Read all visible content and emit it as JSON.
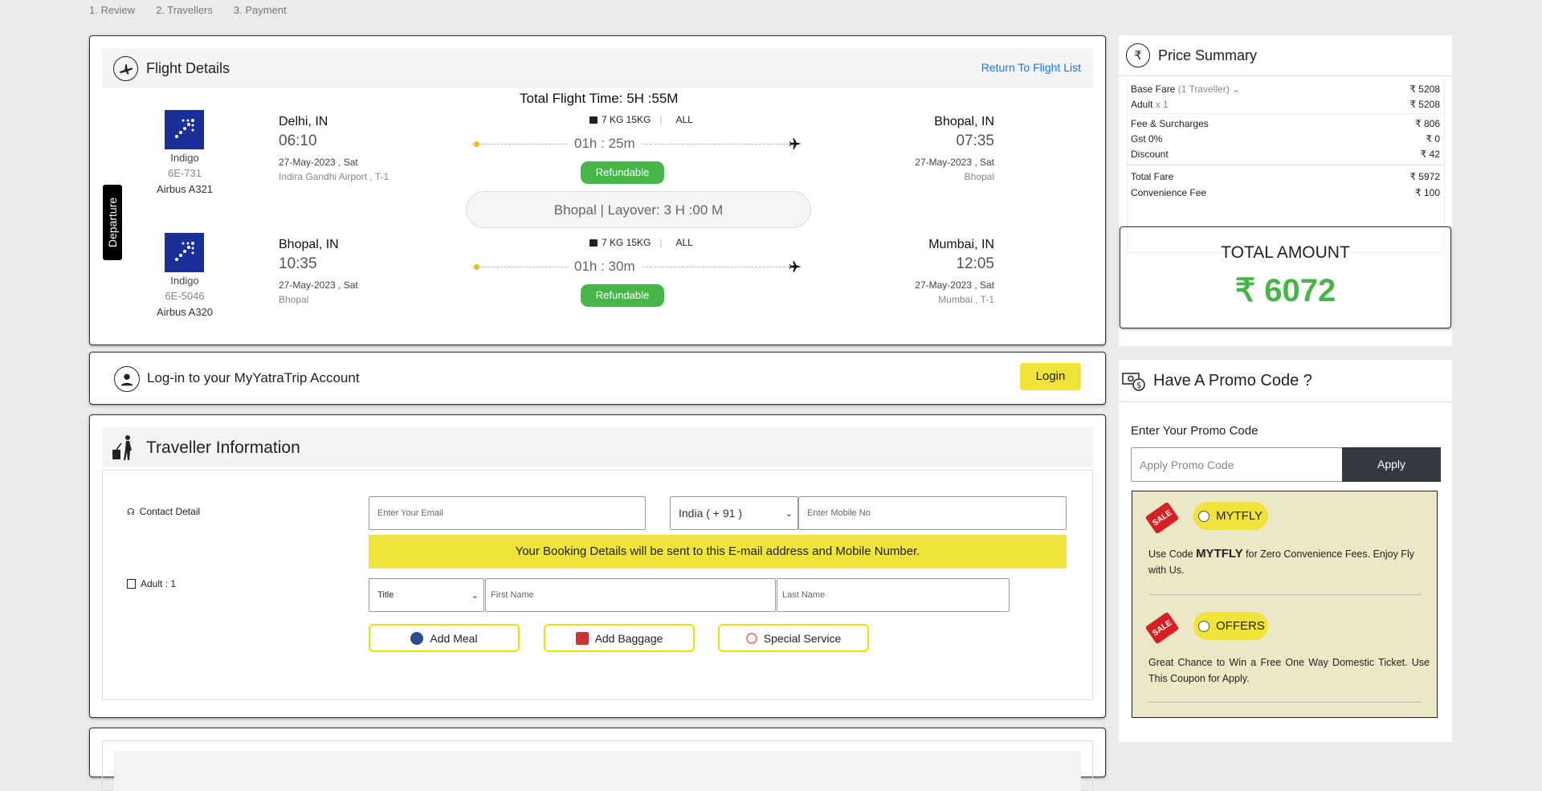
{
  "steps": [
    "1. Review",
    "2. Travellers",
    "3. Payment"
  ],
  "flight": {
    "title": "Flight Details",
    "return_link": "Return To Flight List",
    "total_time": "Total Flight Time: 5H :55M",
    "departure_tab": "Departure",
    "layover": "Bhopal | Layover: 3 H :00 M",
    "segments": [
      {
        "airline": "Indigo",
        "code": "6E-731",
        "aircraft": "Airbus A321",
        "from_city": "Delhi, IN",
        "dep_time": "06:10",
        "dep_date": "27-May-2023 , Sat",
        "dep_airport": "Indira Gandhi Airport , T-1",
        "baggage": "7 KG 15KG",
        "class": "ALL",
        "duration": "01h : 25m",
        "refund": "Refundable",
        "to_city": "Bhopal, IN",
        "arr_time": "07:35",
        "arr_date": "27-May-2023 , Sat",
        "arr_airport": "Bhopal"
      },
      {
        "airline": "Indigo",
        "code": "6E-5046",
        "aircraft": "Airbus A320",
        "from_city": "Bhopal, IN",
        "dep_time": "10:35",
        "dep_date": "27-May-2023 , Sat",
        "dep_airport": "Bhopal",
        "baggage": "7 KG 15KG",
        "class": "ALL",
        "duration": "01h : 30m",
        "refund": "Refundable",
        "to_city": "Mumbai, IN",
        "arr_time": "12:05",
        "arr_date": "27-May-2023 , Sat",
        "arr_airport": "Mumbai , T-1"
      }
    ]
  },
  "login": {
    "text": "Log-in to your MyYatraTrip Account",
    "button": "Login"
  },
  "traveller": {
    "title": "Traveller Information",
    "contact_label": "Contact Detail",
    "email_placeholder": "Enter Your Email",
    "country_code": "India ( + 91 )",
    "mobile_placeholder": "Enter Mobile No",
    "notice": "Your Booking Details will be sent to this E-mail address and Mobile Number.",
    "adult_label": "Adult : 1",
    "title_select": "Title",
    "first_name_placeholder": "First Name",
    "last_name_placeholder": "Last Name",
    "add_meal": "Add Meal",
    "add_baggage": "Add Baggage",
    "special_service": "Special Service"
  },
  "price": {
    "title": "Price Summary",
    "currency": "₹",
    "base_fare_label": "Base Fare",
    "base_fare_traveller": "(1 Traveller)",
    "base_fare": "5208",
    "adult_label": "Adult",
    "adult_count": "x 1",
    "adult_fare": "5208",
    "fee_label": "Fee & Surcharges",
    "fee": "806",
    "gst_label": "Gst 0%",
    "gst": "0",
    "discount_label": "Discount",
    "discount": "42",
    "total_fare_label": "Total Fare",
    "total_fare": "5972",
    "convenience_label": "Convenience Fee",
    "convenience": "100",
    "total_amount_label": "TOTAL AMOUNT",
    "total_amount": "6072"
  },
  "promo": {
    "title": "Have A Promo Code ?",
    "label": "Enter Your Promo Code",
    "placeholder": "Apply Promo Code",
    "apply": "Apply",
    "sale_tag": "SALE",
    "offers": [
      {
        "code": "MYTFLY",
        "desc_prefix": "Use Code ",
        "desc_code": "MYTFLY",
        "desc_suffix": " for Zero Convenience Fees. Enjoy Fly with Us."
      },
      {
        "code": "OFFERS",
        "desc_prefix": "Great Chance to Win a Free One Way Domestic Ticket. Use This Coupon for Apply.",
        "desc_code": "",
        "desc_suffix": ""
      }
    ]
  },
  "colors": {
    "accent_green": "#46b649",
    "accent_yellow": "#f0e43a",
    "link_blue": "#1a73e8",
    "logo_blue": "#1a2f9a",
    "dark_button": "#343a40"
  }
}
